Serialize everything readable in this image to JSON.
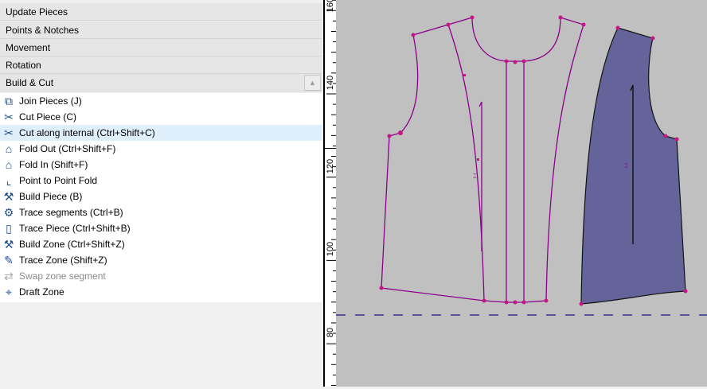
{
  "panel": {
    "sections": [
      "Update Pieces",
      "Points & Notches",
      "Movement",
      "Rotation",
      "Build & Cut"
    ],
    "collapse_icon": "triangle-up-icon",
    "items": [
      {
        "label": "Join Pieces (J)",
        "icon": "join-pieces-icon"
      },
      {
        "label": "Cut Piece (C)",
        "icon": "cut-piece-icon"
      },
      {
        "label": "Cut along internal (Ctrl+Shift+C)",
        "icon": "cut-internal-icon",
        "highlighted": true
      },
      {
        "label": "Fold Out (Ctrl+Shift+F)",
        "icon": "fold-out-icon"
      },
      {
        "label": "Fold In (Shift+F)",
        "icon": "fold-in-icon"
      },
      {
        "label": "Point to Point Fold",
        "icon": "point-fold-icon"
      },
      {
        "label": "Build Piece (B)",
        "icon": "build-piece-icon"
      },
      {
        "label": "Trace segments (Ctrl+B)",
        "icon": "trace-segments-icon"
      },
      {
        "label": "Trace Piece (Ctrl+Shift+B)",
        "icon": "trace-piece-icon"
      },
      {
        "label": "Build Zone (Ctrl+Shift+Z)",
        "icon": "build-zone-icon"
      },
      {
        "label": "Trace Zone (Shift+Z)",
        "icon": "trace-zone-icon"
      },
      {
        "label": "Swap zone segment",
        "icon": "swap-zone-icon",
        "disabled": true
      },
      {
        "label": "Draft Zone",
        "icon": "draft-zone-icon"
      }
    ]
  },
  "ruler": {
    "labels": [
      "160",
      "140",
      "120",
      "100",
      "80"
    ]
  },
  "colors": {
    "canvas": "#c0c0c0",
    "piece_line": "#8b008b",
    "point": "#c71585",
    "selected_fill": "#64649a",
    "dash": "#1a1a80"
  }
}
